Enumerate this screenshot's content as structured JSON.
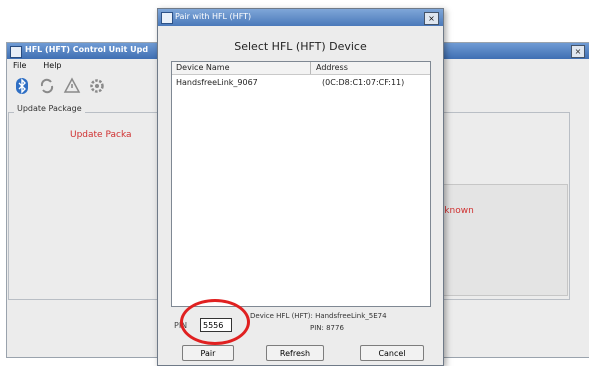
{
  "main_window": {
    "title": "HFL (HFT) Control Unit Upd",
    "close_label": "×",
    "menu": [
      "File",
      "Help"
    ],
    "toolbar_icons": [
      "bluetooth-icon",
      "sync-icon",
      "warning-icon",
      "gear-icon"
    ],
    "group_label": "Update Package",
    "update_text": "Update Packa",
    "status_text": "Unknown"
  },
  "dialog": {
    "title": "Pair with HFL (HFT)",
    "close_label": "×",
    "heading": "Select HFL (HFT) Device",
    "columns": [
      "Device Name",
      "Address"
    ],
    "devices": [
      {
        "name": "HandsfreeLink_9067",
        "address": "(0C:D8:C1:07:CF:11)"
      }
    ],
    "pin_label": "PIN",
    "pin_value": "5556",
    "info_line1": "Device HFL (HFT): HandsfreeLink_5E74",
    "info_line2": "PIN: 8776",
    "buttons": {
      "pair": "Pair",
      "refresh": "Refresh",
      "cancel": "Cancel"
    }
  },
  "colors": {
    "accent_red": "#e02020",
    "titlebar_blue": "#4a79ba"
  }
}
